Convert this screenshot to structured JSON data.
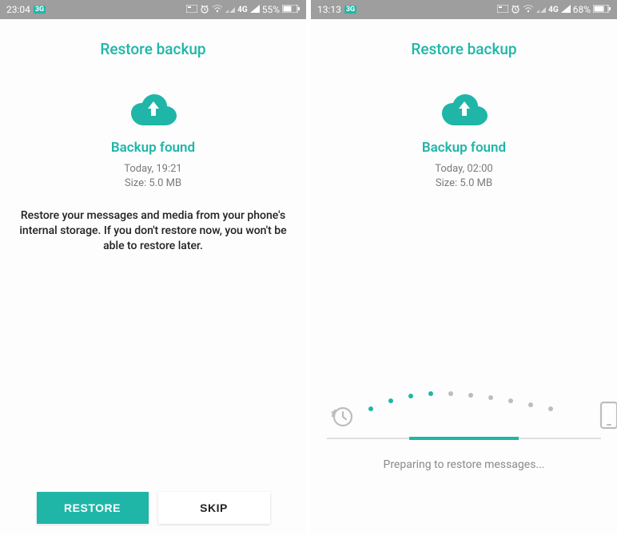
{
  "left": {
    "status": {
      "time": "23:04",
      "net": "4G",
      "battery": "55%"
    },
    "title": "Restore backup",
    "backup_heading": "Backup found",
    "backup_time": "Today, 19:21",
    "backup_size": "Size: 5.0 MB",
    "description": "Restore your messages and media from your phone's internal storage. If you don't restore now, you won't be able to restore later.",
    "restore_label": "RESTORE",
    "skip_label": "SKIP"
  },
  "right": {
    "status": {
      "time": "13:13",
      "net": "4G",
      "battery": "68%"
    },
    "title": "Restore backup",
    "backup_heading": "Backup found",
    "backup_time": "Today, 02:00",
    "backup_size": "Size: 5.0 MB",
    "status_msg": "Preparing to restore messages..."
  }
}
